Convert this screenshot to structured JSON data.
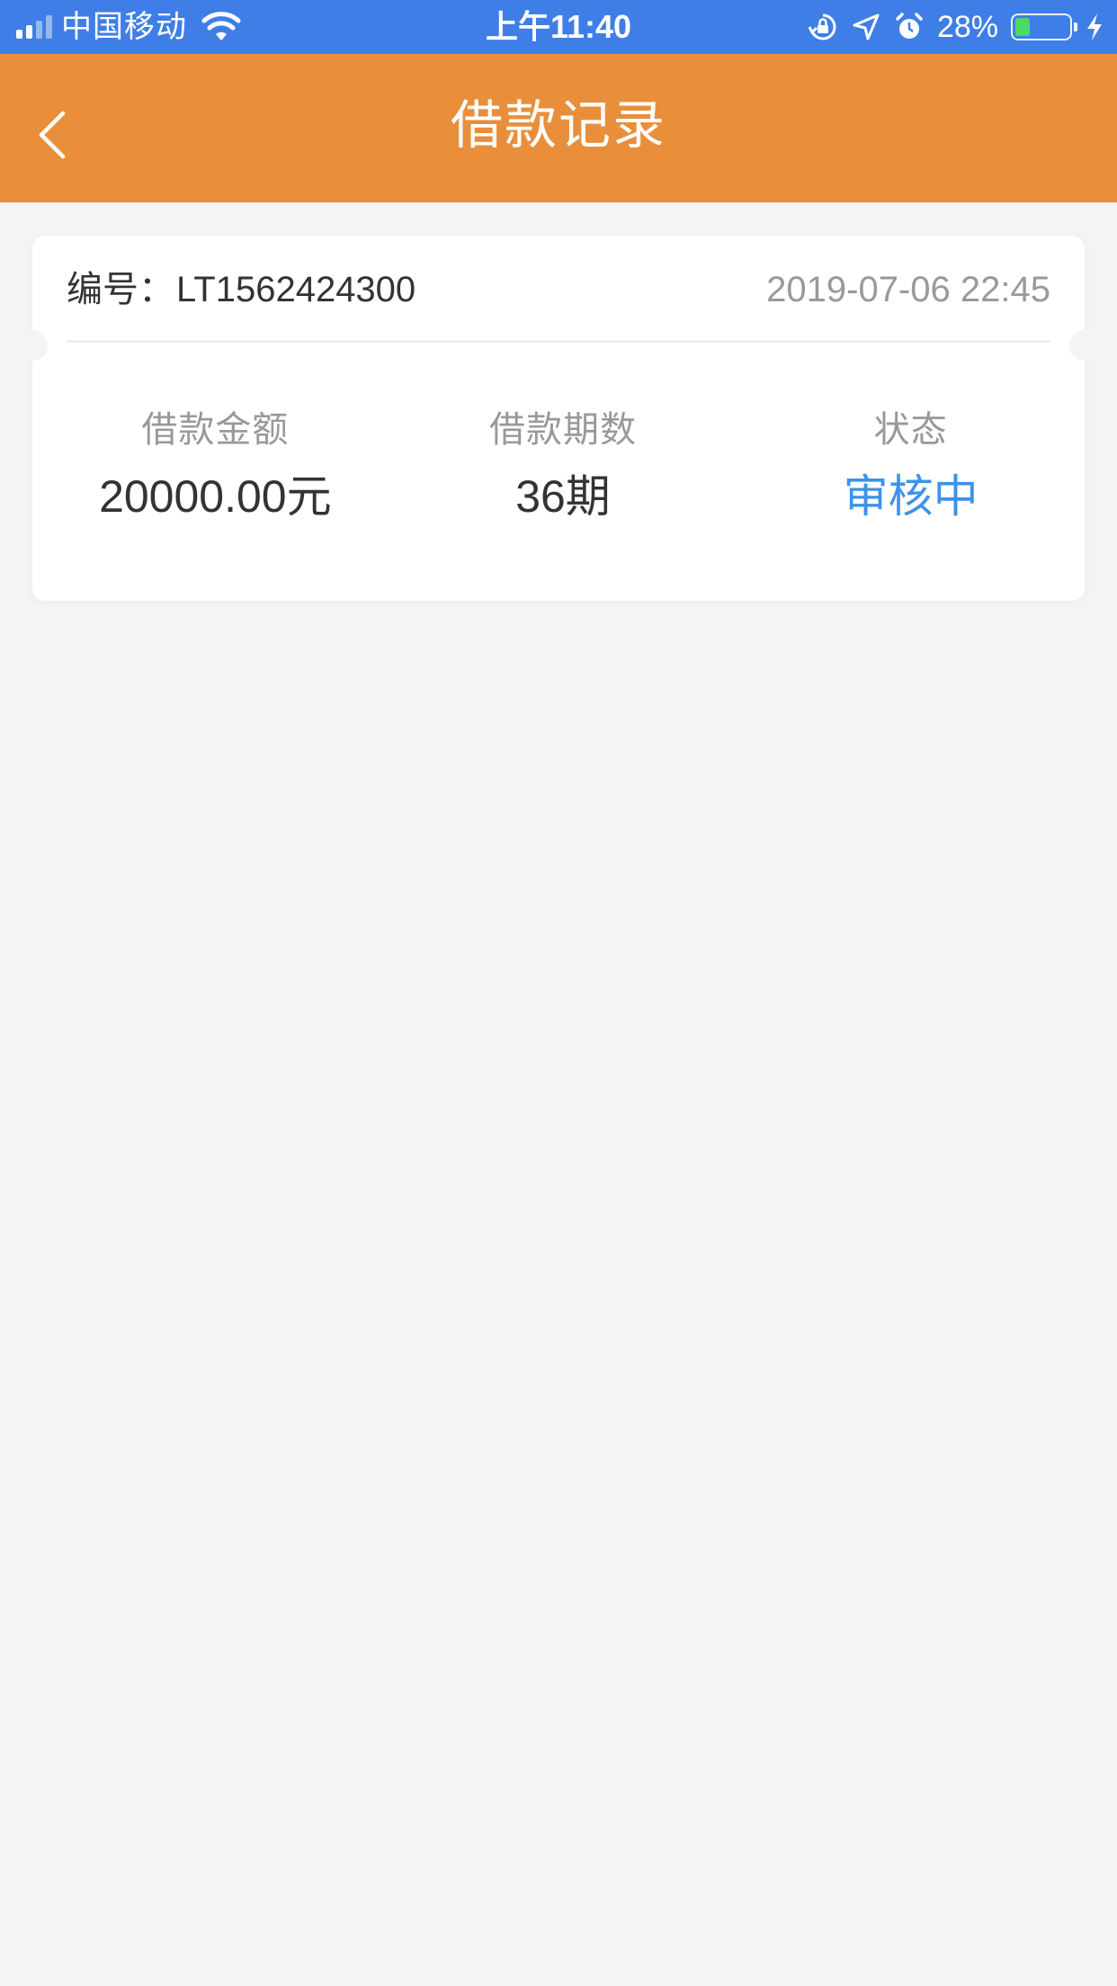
{
  "status_bar": {
    "carrier": "中国移动",
    "time": "上午11:40",
    "battery_percent": "28%",
    "battery_level": 0.28,
    "signal_bars_filled": 2,
    "signal_bars_total": 4,
    "icons": [
      "signal-icon",
      "wifi-icon",
      "rotation-lock-icon",
      "location-icon",
      "alarm-icon",
      "battery-icon",
      "charging-bolt-icon"
    ]
  },
  "nav": {
    "title": "借款记录",
    "back_icon": "chevron-left-icon"
  },
  "record": {
    "order_label": "编号：",
    "order_number": "LT1562424300",
    "date": "2019-07-06 22:45",
    "amount_label": "借款金额",
    "amount_value": "20000.00元",
    "periods_label": "借款期数",
    "periods_value": "36期",
    "status_label": "状态",
    "status_value": "审核中"
  },
  "colors": {
    "status_bar": "#3f7ee6",
    "nav_bar": "#e98f3b",
    "background": "#f3f4f6",
    "status_text": "#3d93e9"
  }
}
